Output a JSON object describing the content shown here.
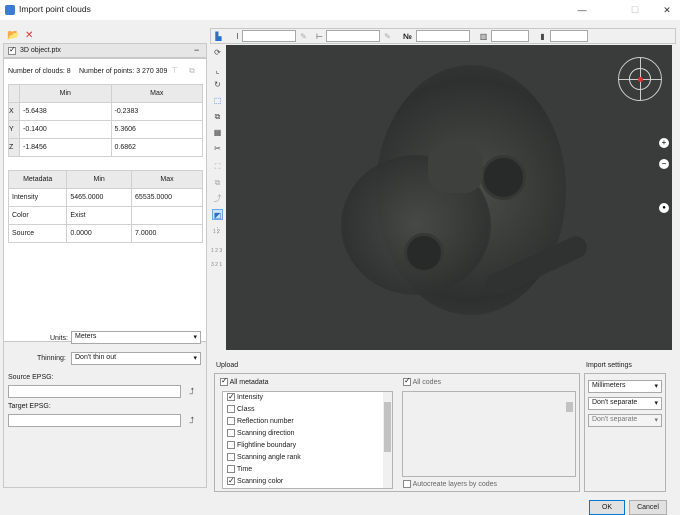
{
  "window": {
    "title": "Import point clouds",
    "minimize": "—",
    "maximize": "☐",
    "close": "✕"
  },
  "file": {
    "name": "3D object.ptx",
    "collapse": "−"
  },
  "stats": {
    "clouds_label": "Number of clouds:",
    "clouds": "8",
    "points_label": "Number of points:",
    "points": "3 270 309"
  },
  "bounds": {
    "headers": [
      "Min",
      "Max"
    ],
    "rows": [
      {
        "axis": "X",
        "min": "-5.6438",
        "max": "-0.2383"
      },
      {
        "axis": "Y",
        "min": "-0.1400",
        "max": "5.3606"
      },
      {
        "axis": "Z",
        "min": "-1.8456",
        "max": "0.6862"
      }
    ]
  },
  "metadata": {
    "headers": [
      "Metadata",
      "Min",
      "Max"
    ],
    "rows": [
      {
        "name": "Intensity",
        "min": "5465.0000",
        "max": "65535.0000"
      },
      {
        "name": "Color",
        "min": "Exist",
        "max": ""
      },
      {
        "name": "Source",
        "min": "0.0000",
        "max": "7.0000"
      }
    ]
  },
  "options": {
    "units_label": "Units:",
    "units": "Meters",
    "thinning_label": "Thinning:",
    "thinning": "Don't thin out",
    "source_epsg_label": "Source EPSG:",
    "target_epsg_label": "Target EPSG:"
  },
  "top_toolbar": {
    "number_sign": "№"
  },
  "side_tools": {
    "label_12": "1 2",
    "label_123": "1 2 3",
    "label_321": "3 2 1"
  },
  "upload": {
    "title": "Upload",
    "all_metadata": "All metadata",
    "items": [
      {
        "label": "Intensity",
        "checked": true
      },
      {
        "label": "Class",
        "checked": false
      },
      {
        "label": "Reflection number",
        "checked": false
      },
      {
        "label": "Scanning direction",
        "checked": false
      },
      {
        "label": "Flightline boundary",
        "checked": false
      },
      {
        "label": "Scanning angle rank",
        "checked": false
      },
      {
        "label": "Time",
        "checked": false
      },
      {
        "label": "Scanning color",
        "checked": true
      }
    ],
    "all_codes": "All codes",
    "autocreate": "Autocreate layers by codes"
  },
  "import_settings": {
    "title": "Import settings",
    "units": "Millimeters",
    "separate1": "Don't separate",
    "separate2": "Don't separate"
  },
  "buttons": {
    "ok": "OK",
    "cancel": "Cancel"
  },
  "nav": {
    "zoom_in": "+",
    "zoom_out": "−",
    "center": "●"
  }
}
